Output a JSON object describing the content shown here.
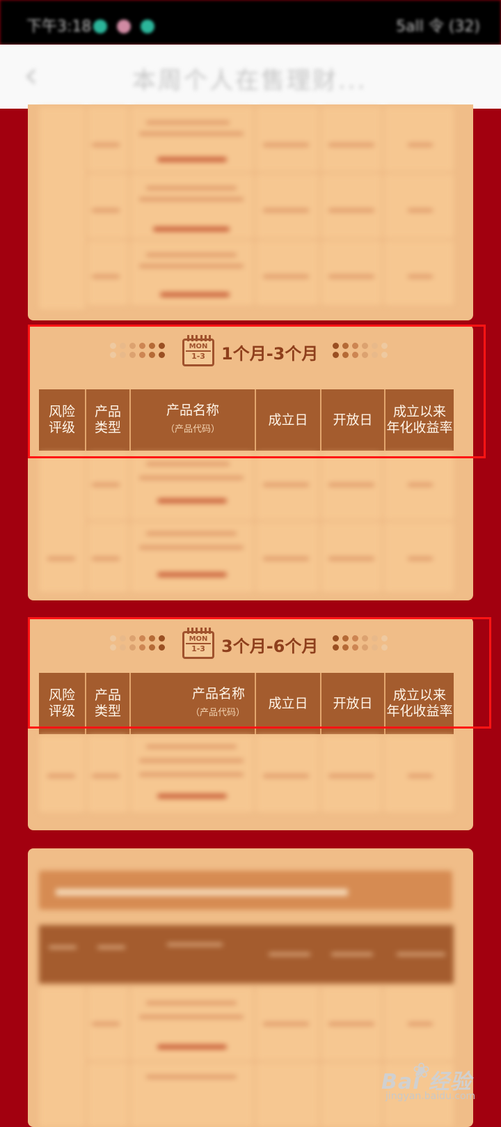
{
  "status_bar": {
    "time": "下午3:18",
    "signal": "5all 令 (32)"
  },
  "app_bar": {
    "title": "本周个人在售理财..."
  },
  "sections": [
    {
      "icon_text": {
        "mon": "MON",
        "num": "1-3"
      },
      "title": "1个月-3个月",
      "headers": {
        "risk": [
          "风险",
          "评级"
        ],
        "type": [
          "产品",
          "类型"
        ],
        "name": "产品名称",
        "code": "（产品代码）",
        "start": "成立日",
        "open": "开放日",
        "yield": [
          "成立以来",
          "年化收益率"
        ]
      }
    },
    {
      "icon_text": {
        "mon": "MON",
        "num": "1-3"
      },
      "title": "3个月-6个月",
      "headers": {
        "risk": [
          "风险",
          "评级"
        ],
        "type": [
          "产品",
          "类型"
        ],
        "name": "产品名称",
        "code": "（产品代码）",
        "start": "成立日",
        "open": "开放日",
        "yield": [
          "成立以来",
          "年化收益率"
        ]
      }
    }
  ],
  "colors": {
    "background": "#a2000f",
    "panel": "#f0bd88",
    "header": "#a45c2e",
    "title_text": "#8e3f1c",
    "highlight": "#ff1414"
  },
  "watermark": {
    "brand": "Bai 经验",
    "url": "jingyan.baidu.com"
  }
}
